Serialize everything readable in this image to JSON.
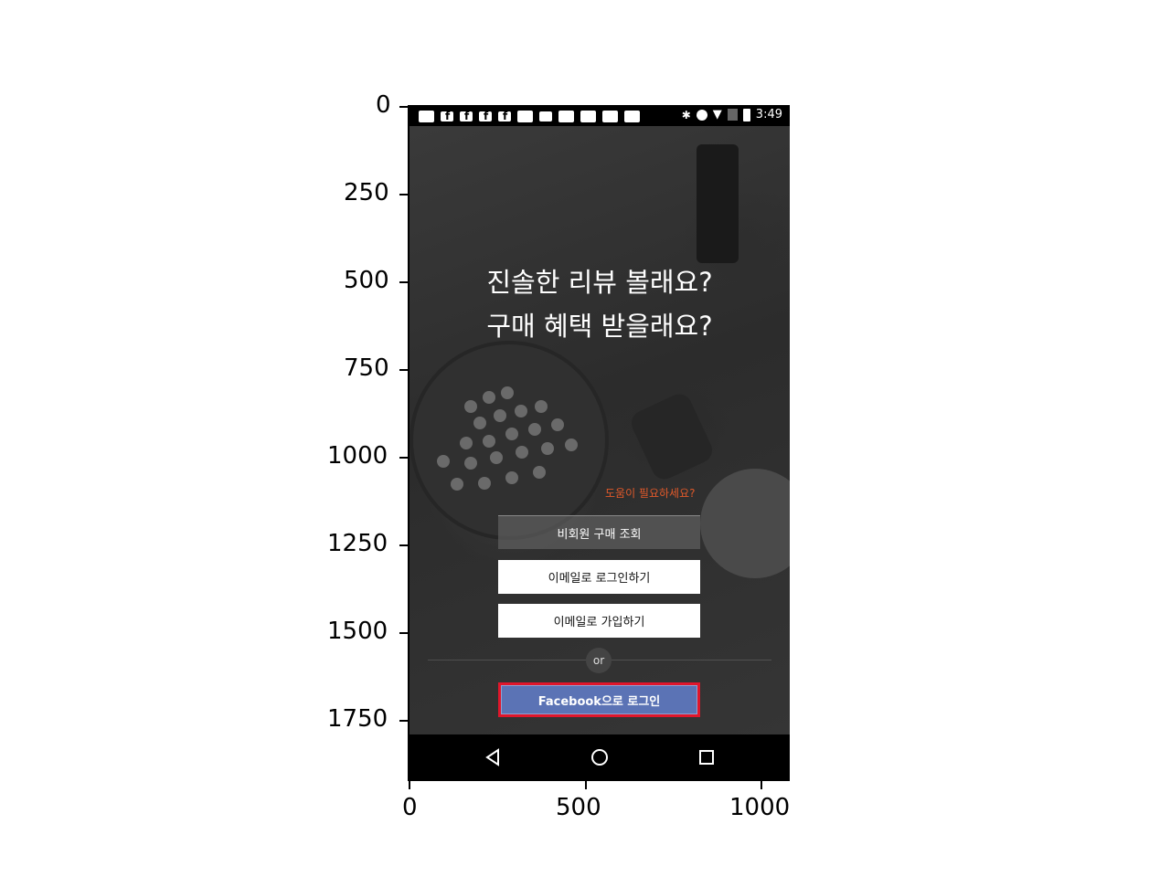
{
  "axes": {
    "y_ticks": [
      "0",
      "250",
      "500",
      "750",
      "1000",
      "1250",
      "1500",
      "1750"
    ],
    "x_ticks": [
      "0",
      "500",
      "1000"
    ]
  },
  "status_bar": {
    "time": "3:49",
    "icons": [
      "message-icon",
      "facebook-icon",
      "facebook-icon",
      "facebook-icon",
      "facebook-icon",
      "app-icon",
      "app-icon",
      "square-icon",
      "app-icon",
      "app-icon",
      "app-icon",
      "app-icon",
      "bluetooth-icon",
      "do-not-disturb-icon",
      "wifi-icon",
      "no-sim-icon",
      "battery-charging-icon"
    ]
  },
  "headline": {
    "line1": "진솔한 리뷰 볼래요?",
    "line2": "구매 혜택 받을래요?"
  },
  "help_link": "도움이 필요하세요?",
  "buttons": {
    "guest_order": "비회원 구매 조회",
    "email_login": "이메일로 로그인하기",
    "email_signup": "이메일로 가입하기",
    "or": "or",
    "facebook_login": "Facebook으로 로그인"
  },
  "colors": {
    "help_link": "#e0592a",
    "facebook": "#5b73b5",
    "highlight": "#e0162b"
  }
}
